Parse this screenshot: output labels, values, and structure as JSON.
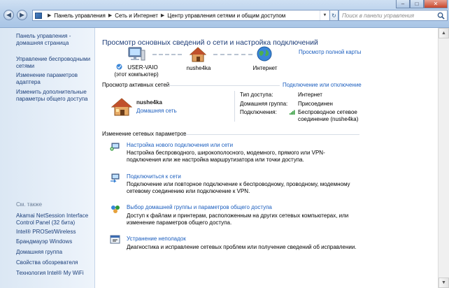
{
  "window": {
    "breadcrumbs": [
      "Панель управления",
      "Сеть и Интернет",
      "Центр управления сетями и общим доступом"
    ],
    "search_placeholder": "Поиск в панели управления",
    "minimize": "–",
    "maximize": "□",
    "close": "✕"
  },
  "sidebar": {
    "items": [
      {
        "label": "Панель управления - домашняя страница"
      },
      {
        "label": "Управление беспроводными сетями"
      },
      {
        "label": "Изменение параметров адаптера"
      },
      {
        "label": "Изменить дополнительные параметры общего доступа"
      }
    ],
    "see_also_title": "См. также",
    "see_also": [
      {
        "label": "Akamai NetSession Interface Control Panel (32 бита)"
      },
      {
        "label": "Intel® PROSet/Wireless"
      },
      {
        "label": "Брандмауэр Windows"
      },
      {
        "label": "Домашняя группа"
      },
      {
        "label": "Свойства обозревателя"
      },
      {
        "label": "Технология Intel® My WiFi"
      }
    ]
  },
  "main": {
    "title": "Просмотр основных сведений о сети и настройка подключений",
    "full_map_link": "Просмотр полной карты",
    "nodes": {
      "computer_name": "USER-VAIO",
      "computer_sub": "(этот компьютер)",
      "network_name": "nushe4ka",
      "internet": "Интернет"
    },
    "active_section": {
      "title": "Просмотр активных сетей",
      "connect_link": "Подключение или отключение",
      "network_name": "nushe4ka",
      "network_type": "Домашняя сеть",
      "access_type_label": "Тип доступа:",
      "access_type_value": "Интернет",
      "homegroup_label": "Домашняя группа:",
      "homegroup_value": "Присоединен",
      "connections_label": "Подключения:",
      "connections_value_line1": "Беспроводное сетевое",
      "connections_value_line2": "соединение (nushe4ka)"
    },
    "change_section": {
      "title": "Изменение сетевых параметров",
      "tasks": [
        {
          "title": "Настройка нового подключения или сети",
          "desc": "Настройка беспроводного, широкополосного, модемного, прямого или VPN-подключения или же настройка маршрутизатора или точки доступа."
        },
        {
          "title": "Подключиться к сети",
          "desc": "Подключение или повторное подключение к беспроводному, проводному, модемному сетевому соединению или подключение к VPN."
        },
        {
          "title": "Выбор домашней группы и параметров общего доступа",
          "desc": "Доступ к файлам и принтерам, расположенным на других сетевых компьютерах, или изменение параметров общего доступа."
        },
        {
          "title": "Устранение неполадок",
          "desc": "Диагностика и исправление сетевых проблем или получение сведений об исправлении."
        }
      ]
    }
  }
}
